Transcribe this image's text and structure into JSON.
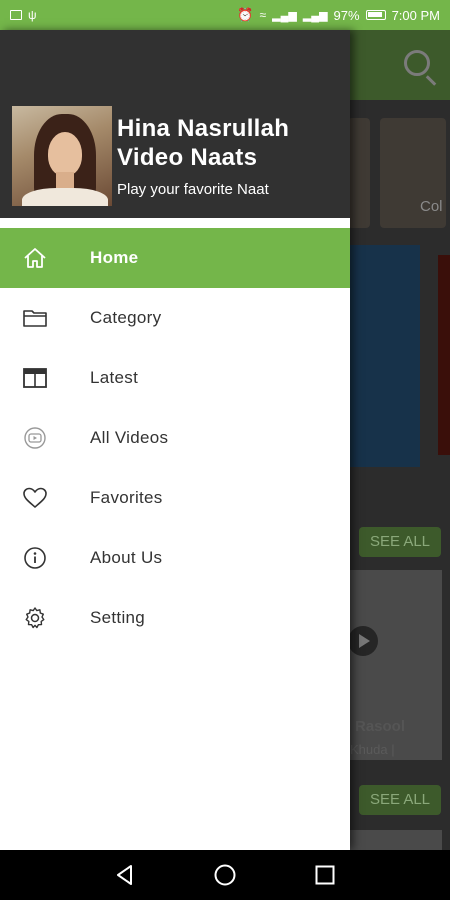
{
  "status_bar": {
    "battery_percent": "97%",
    "time": "7:00 PM"
  },
  "drawer": {
    "header": {
      "title": "Hina Nasrullah Video Naats",
      "subtitle": "Play your favorite Naat"
    },
    "menu": [
      {
        "label": "Home",
        "icon": "home-icon",
        "active": true
      },
      {
        "label": "Category",
        "icon": "folder-icon",
        "active": false
      },
      {
        "label": "Latest",
        "icon": "window-icon",
        "active": false
      },
      {
        "label": "All Videos",
        "icon": "youtube-icon",
        "active": false
      },
      {
        "label": "Favorites",
        "icon": "heart-icon",
        "active": false
      },
      {
        "label": "About Us",
        "icon": "info-icon",
        "active": false
      },
      {
        "label": "Setting",
        "icon": "gear-icon",
        "active": false
      }
    ],
    "colors": {
      "accent": "#74b64a",
      "header_bg": "#313131"
    }
  },
  "background_app": {
    "category_label": "Col",
    "see_all_1": "SEE ALL",
    "see_all_2": "SEE ALL",
    "card_title": "Rasool",
    "card_subtitle": "Khuda |"
  }
}
